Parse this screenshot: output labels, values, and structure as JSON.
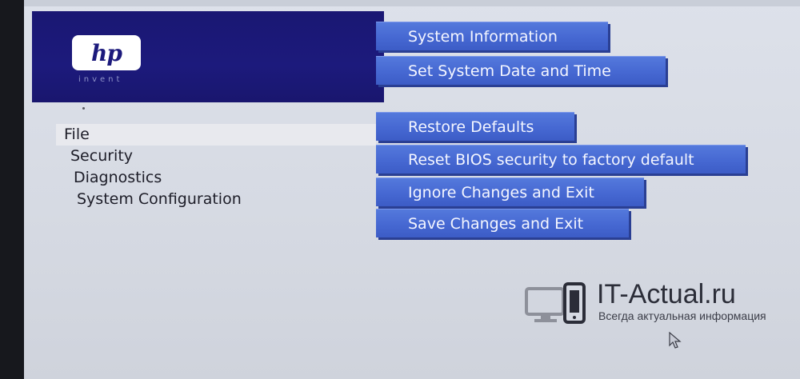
{
  "brand": {
    "logo_text": "hp",
    "tagline": "invent"
  },
  "menu": {
    "items": [
      {
        "label": "File",
        "selected": true
      },
      {
        "label": "Security",
        "selected": false
      },
      {
        "label": "Diagnostics",
        "selected": false
      },
      {
        "label": "System Configuration",
        "selected": false
      }
    ]
  },
  "actions": {
    "system_information": "System Information",
    "set_date_time": "Set System Date and Time",
    "restore_defaults": "Restore Defaults",
    "reset_bios_security": "Reset BIOS security to factory default",
    "ignore_changes_exit": "Ignore Changes and Exit",
    "save_changes_exit": "Save Changes and Exit"
  },
  "watermark": {
    "title": "IT-Actual.ru",
    "subtitle": "Всегда актуальная информация"
  },
  "colors": {
    "panel_navy": "#1a1773",
    "button_blue": "#4668d2",
    "background": "#d6dae3"
  }
}
